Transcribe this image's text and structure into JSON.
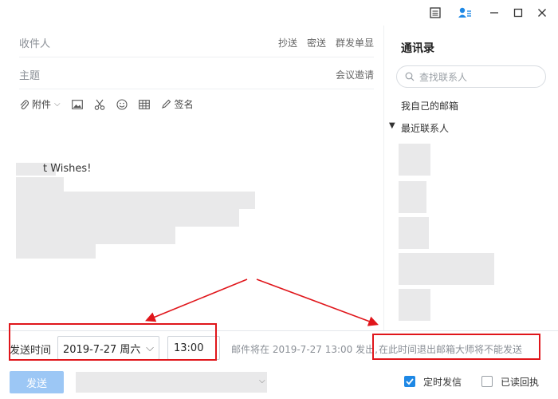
{
  "window": {
    "icons": [
      "layout-icon",
      "contacts-icon",
      "minimize-icon",
      "maximize-icon",
      "close-icon"
    ]
  },
  "compose": {
    "to_placeholder": "收件人",
    "cc_label": "抄送",
    "bcc_label": "密送",
    "group_single_label": "群发单显",
    "subject_placeholder": "主题",
    "meeting_invite_label": "会议邀请",
    "toolbar": {
      "attachment_label": "附件",
      "signature_label": "签名"
    },
    "body_text": "t Wishes!"
  },
  "contacts": {
    "title": "通讯录",
    "search_placeholder": "查找联系人",
    "my_mailbox": "我自己的邮箱",
    "recent": "最近联系人"
  },
  "schedule": {
    "label": "发送时间",
    "date_value": "2019-7-27 周六",
    "time_value": "13:00",
    "info_text": "邮件将在 2019-7-27 13:00 发出,",
    "warning_text": "在此时间退出邮箱大师将不能发送"
  },
  "bottom": {
    "send_label": "发送",
    "scheduled_send_label": "定时发信",
    "scheduled_send_checked": true,
    "read_receipt_label": "已读回执",
    "read_receipt_checked": false
  },
  "colors": {
    "annotation_red": "#e0161b",
    "send_button": "#9cc7f5",
    "checkbox_checked": "#1e88e5"
  }
}
